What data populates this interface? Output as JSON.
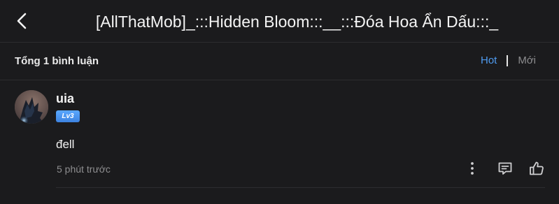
{
  "header": {
    "title": "[AllThatMob]_:::Hidden Bloom:::__:::Đóa Hoa Ẩn Dấu:::_",
    "back_icon": "chevron-left-icon"
  },
  "comments_bar": {
    "total_label": "Tổng 1 bình luận",
    "sort_hot": "Hot",
    "sort_new": "Mới",
    "active_sort_color": "#4f9bf0"
  },
  "comments": [
    {
      "username": "uia",
      "level": "Lv3",
      "text": "đell",
      "time": "5 phút trước",
      "icons": [
        "more-vertical-icon",
        "reply-comment-icon",
        "like-thumb-icon"
      ]
    }
  ]
}
